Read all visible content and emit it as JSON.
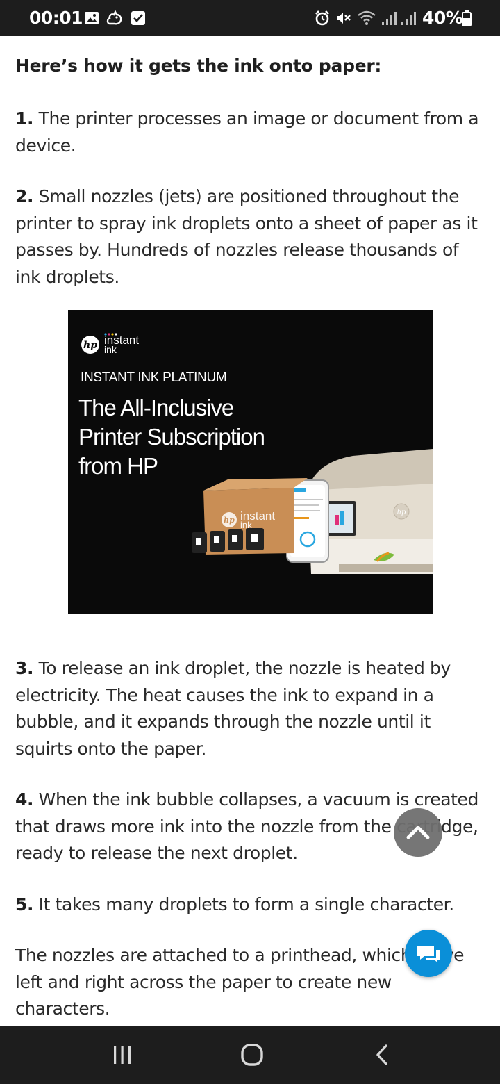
{
  "status_bar": {
    "time": "00:01",
    "battery_percent": "40%",
    "left_icons": [
      "gallery-icon",
      "squirrel-icon",
      "checkbox-icon"
    ],
    "right_icons": [
      "alarm-icon",
      "mute-icon",
      "wifi-icon",
      "signal-icon",
      "signal-icon",
      "battery-icon"
    ]
  },
  "article": {
    "heading": "Here’s how it gets the ink onto paper:",
    "steps": [
      {
        "number": "1.",
        "text": " The printer processes an image or document from a device."
      },
      {
        "number": "2.",
        "text": " Small nozzles (jets) are positioned throughout the printer to spray ink droplets onto a sheet of paper as it passes by. Hundreds of nozzles release thousands of ink droplets."
      },
      {
        "number": "3.",
        "text": " To release an ink droplet, the nozzle is heated by electricity. The heat causes the ink to expand in a bubble, and it expands through the nozzle until it squirts onto the paper."
      },
      {
        "number": "4.",
        "text": " When the ink bubble collapses, a vacuum is created that draws more ink into the nozzle from the cartridge, ready to release the next droplet."
      },
      {
        "number": "5.",
        "text": " It takes many droplets to form a single character."
      }
    ],
    "closing": "The nozzles are attached to a printhead, which move left and right across the paper to create new characters."
  },
  "ad": {
    "logo_brand": "hp",
    "logo_line1": "instant",
    "logo_line2": "ink",
    "tag": "INSTANT INK PLATINUM",
    "headline_lines": [
      "The All-Inclusive",
      "Printer Subscription",
      "from HP"
    ],
    "box_line1": "instant",
    "box_line2": "ink",
    "background": "#0a0a0a"
  },
  "floating": {
    "scroll_top_icon": "chevron-up-icon",
    "chat_icon": "chat-bubbles-icon",
    "chat_color": "#0a8fd8"
  },
  "nav_bar": {
    "buttons": [
      "recents-icon",
      "home-icon",
      "back-icon"
    ]
  }
}
